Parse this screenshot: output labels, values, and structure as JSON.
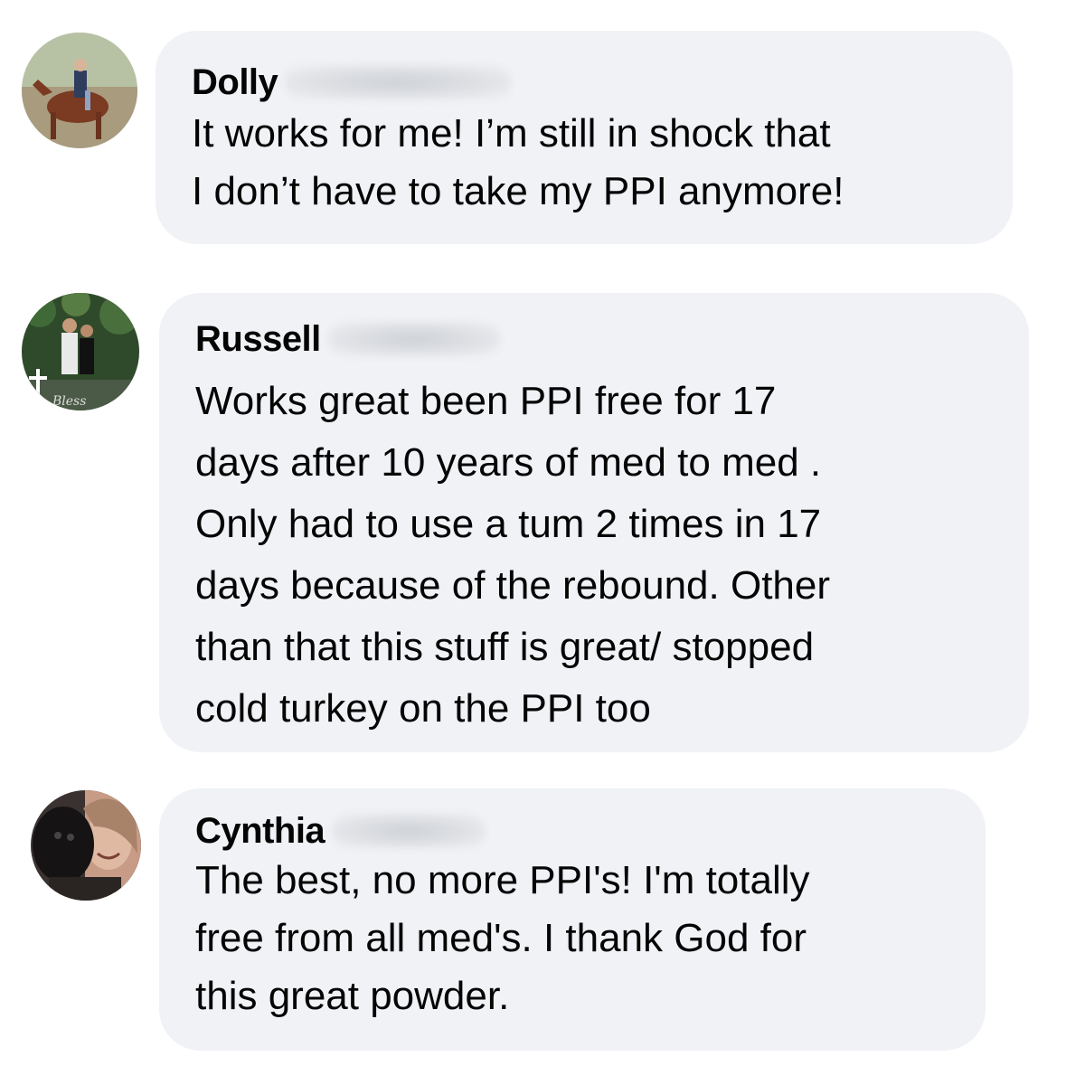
{
  "comments": [
    {
      "author": "Dolly",
      "lines": [
        "It works for me! I’m still in shock that",
        "I don’t have to take my PPI anymore!"
      ]
    },
    {
      "author": "Russell",
      "avatar_caption": "Bless",
      "lines": [
        "Works great been PPI free for 17",
        "days after 10 years of med to med .",
        "Only had to use a tum 2 times in 17",
        "days because of the rebound. Other",
        "than that this stuff is great/ stopped",
        "cold turkey on the PPI too"
      ]
    },
    {
      "author": "Cynthia",
      "lines": [
        "The best, no more PPI's! I'm totally",
        "free from all med's.  I thank God for",
        "this great powder."
      ]
    }
  ],
  "colors": {
    "bubble_bg": "#f0f2f5",
    "text": "#050505",
    "page_bg": "#ffffff"
  }
}
